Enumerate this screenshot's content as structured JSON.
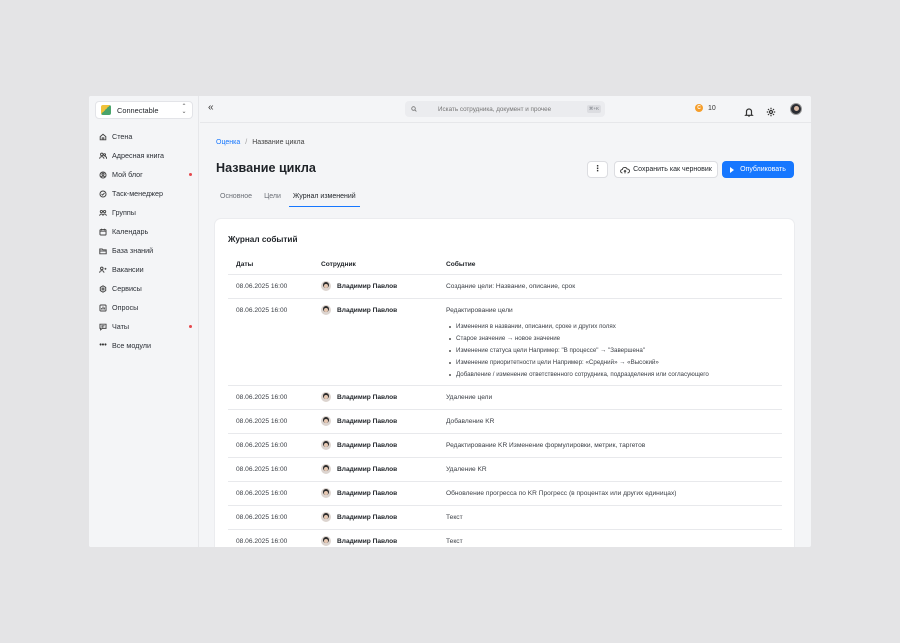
{
  "sidebar": {
    "org_name": "Connectable",
    "items": [
      {
        "label": "Стена",
        "icon": "home-icon",
        "dot": false
      },
      {
        "label": "Адресная книга",
        "icon": "users-icon",
        "dot": false
      },
      {
        "label": "Мой блог",
        "icon": "blog-icon",
        "dot": true
      },
      {
        "label": "Таск-менеджер",
        "icon": "check-circle-icon",
        "dot": false
      },
      {
        "label": "Группы",
        "icon": "group-icon",
        "dot": false
      },
      {
        "label": "Календарь",
        "icon": "calendar-icon",
        "dot": false
      },
      {
        "label": "База знаний",
        "icon": "folder-icon",
        "dot": false
      },
      {
        "label": "Вакансии",
        "icon": "vacancy-icon",
        "dot": false
      },
      {
        "label": "Сервисы",
        "icon": "services-icon",
        "dot": false
      },
      {
        "label": "Опросы",
        "icon": "poll-icon",
        "dot": false
      },
      {
        "label": "Чаты",
        "icon": "chat-icon",
        "dot": true
      },
      {
        "label": "Все модули",
        "icon": "more-icon",
        "dot": false
      }
    ]
  },
  "topbar": {
    "collapse_glyph": "«",
    "search_placeholder": "Искать сотрудника, документ и прочее",
    "search_shortcut": "⌘+K",
    "coin_glyph": "C",
    "coins": "10"
  },
  "breadcrumb": {
    "link": "Оценка",
    "separator": "/",
    "current": "Название цикла"
  },
  "page": {
    "title": "Название цикла",
    "more_glyph": "⋮",
    "save_draft_label": "Сохранить как черновик",
    "publish_label": "Опубликовать"
  },
  "tabs": [
    {
      "label": "Основное",
      "active": false
    },
    {
      "label": "Цели",
      "active": false
    },
    {
      "label": "Журнал изменений",
      "active": true
    }
  ],
  "journal": {
    "title": "Журнал событий",
    "columns": {
      "date": "Даты",
      "employee": "Сотрудник",
      "event": "Событие"
    },
    "rows": [
      {
        "date": "08.06.2025 16:00",
        "employee": "Владимир Павлов",
        "event": "Создание цели: Название, описание, срок",
        "details": []
      },
      {
        "date": "08.06.2025 16:00",
        "employee": "Владимир Павлов",
        "event": "Редактирование цели",
        "details": [
          "Изменения в названии, описании, сроке и других полях",
          "Старое значение → новое значение",
          "Изменение статуса цели Например:  \"В процессе\" → \"Завершена\"",
          "Изменение приоритетности цели Например: «Средний» → «Высокий»",
          "Добавление / изменение ответственного сотрудника, подразделения или согласующего"
        ]
      },
      {
        "date": "08.06.2025 16:00",
        "employee": "Владимир Павлов",
        "event": "Удаление цели",
        "details": []
      },
      {
        "date": "08.06.2025 16:00",
        "employee": "Владимир Павлов",
        "event": "Добавление KR",
        "details": []
      },
      {
        "date": "08.06.2025 16:00",
        "employee": "Владимир Павлов",
        "event": "Редактирование KR Изменение формулировки, метрик, таргетов",
        "details": []
      },
      {
        "date": "08.06.2025 16:00",
        "employee": "Владимир Павлов",
        "event": "Удаление KR",
        "details": []
      },
      {
        "date": "08.06.2025 16:00",
        "employee": "Владимир Павлов",
        "event": "Обновление прогресса по KR Прогресс (в процентах или других единицах)",
        "details": []
      },
      {
        "date": "08.06.2025 16:00",
        "employee": "Владимир Павлов",
        "event": "Текст",
        "details": []
      },
      {
        "date": "08.06.2025 16:00",
        "employee": "Владимир Павлов",
        "event": "Текст",
        "details": []
      }
    ]
  },
  "colors": {
    "accent": "#1677ff",
    "badge_dot": "#e5484d",
    "coin": "#f59e2b"
  }
}
